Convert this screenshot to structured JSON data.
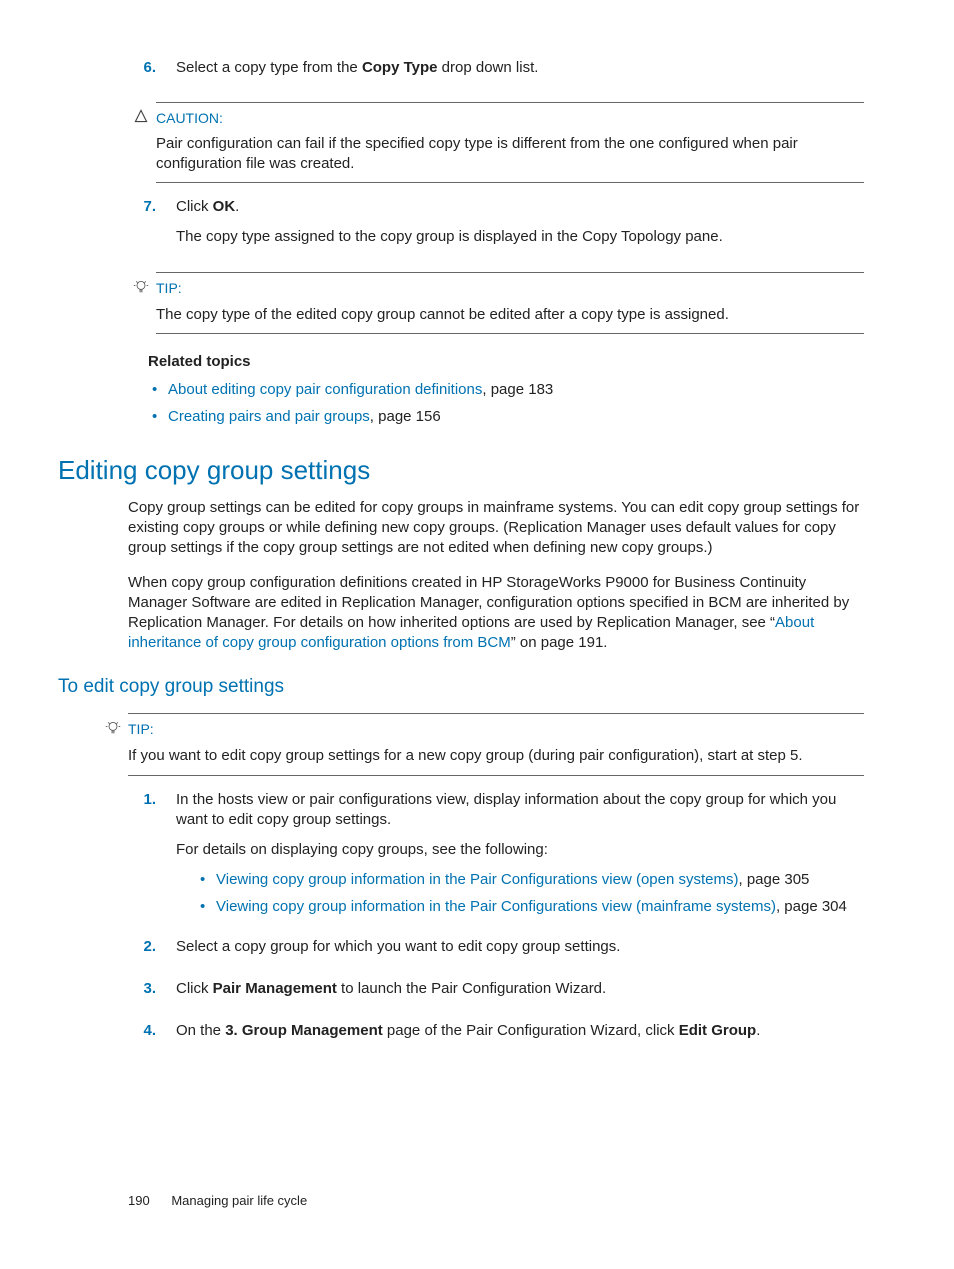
{
  "steps_top": {
    "s6": {
      "num": "6.",
      "t1": "Select a copy type from the ",
      "b1": "Copy Type",
      "t2": " drop down list."
    },
    "caution_label": "CAUTION:",
    "caution_text": "Pair configuration can fail if the specified copy type is different from the one configured when pair configuration file was created.",
    "s7": {
      "num": "7.",
      "t1": "Click ",
      "b1": "OK",
      "t2": ".",
      "p2": "The copy type assigned to the copy group is displayed in the Copy Topology pane."
    },
    "tip_label": "TIP:",
    "tip_text": "The copy type of the edited copy group cannot be edited after a copy type is assigned."
  },
  "related": {
    "heading": "Related topics",
    "r1": {
      "link": "About editing copy pair configuration definitions",
      "tail": ", page 183"
    },
    "r2": {
      "link": "Creating pairs and pair groups",
      "tail": ", page 156"
    }
  },
  "section_h": "Editing copy group settings",
  "para1": "Copy group settings can be edited for copy groups in mainframe systems. You can edit copy group settings for existing copy groups or while defining new copy groups. (Replication Manager uses default values for copy group settings if the copy group settings are not edited when defining new copy groups.)",
  "para2_a": "When copy group configuration definitions created in HP StorageWorks P9000 for Business Continuity Manager Software are edited in Replication Manager, configuration options specified in BCM are inherited by Replication Manager. For details on how inherited options are used by Replication Manager, see “",
  "para2_link": "About inheritance of copy group configuration options from BCM",
  "para2_b": "” on page 191.",
  "sub_h": "To edit copy group settings",
  "tip2_label": "TIP:",
  "tip2_text": "If you want to edit copy group settings for a new copy group (during pair configuration), start at step 5.",
  "steps2": {
    "s1": {
      "num": "1.",
      "p1": "In the hosts view or pair configurations view, display information about the copy group for which you want to edit copy group settings.",
      "p2": "For details on displaying copy groups, see the following:"
    },
    "s1b1": {
      "link": "Viewing copy group information in the Pair Configurations view (open systems)",
      "tail": ", page 305"
    },
    "s1b2": {
      "link": "Viewing copy group information in the Pair Configurations view (mainframe systems)",
      "tail": ", page 304"
    },
    "s2": {
      "num": "2.",
      "p1": "Select a copy group for which you want to edit copy group settings."
    },
    "s3": {
      "num": "3.",
      "t1": "Click ",
      "b1": "Pair Management",
      "t2": " to launch the Pair Configuration Wizard."
    },
    "s4": {
      "num": "4.",
      "t1": "On the ",
      "b1": "3. Group Management",
      "t2": " page of the Pair Configuration Wizard, click ",
      "b2": "Edit Group",
      "t3": "."
    }
  },
  "footer": {
    "page": "190",
    "title": "Managing pair life cycle"
  }
}
